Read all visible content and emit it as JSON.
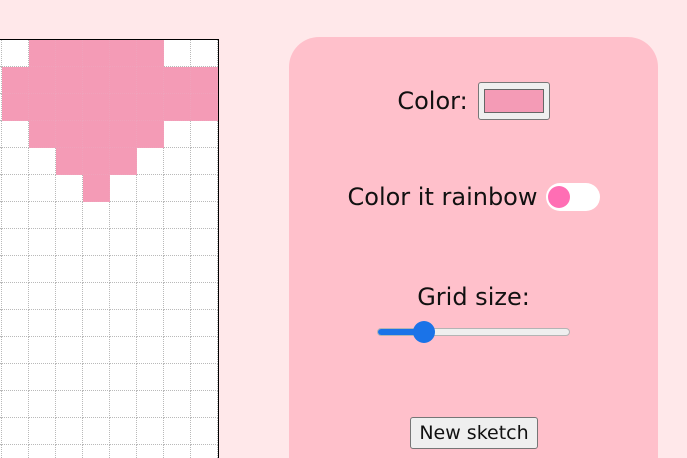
{
  "canvas": {
    "columns": 9,
    "rows": 16,
    "filled_color": "#f49bb6",
    "filled_cells": [
      [
        0,
        2
      ],
      [
        0,
        3
      ],
      [
        0,
        4
      ],
      [
        0,
        5
      ],
      [
        0,
        6
      ],
      [
        1,
        1
      ],
      [
        1,
        2
      ],
      [
        1,
        3
      ],
      [
        1,
        4
      ],
      [
        1,
        5
      ],
      [
        1,
        6
      ],
      [
        1,
        7
      ],
      [
        1,
        8
      ],
      [
        2,
        1
      ],
      [
        2,
        2
      ],
      [
        2,
        3
      ],
      [
        2,
        4
      ],
      [
        2,
        5
      ],
      [
        2,
        6
      ],
      [
        2,
        7
      ],
      [
        2,
        8
      ],
      [
        3,
        2
      ],
      [
        3,
        3
      ],
      [
        3,
        4
      ],
      [
        3,
        5
      ],
      [
        3,
        6
      ],
      [
        4,
        3
      ],
      [
        4,
        4
      ],
      [
        4,
        5
      ],
      [
        5,
        4
      ]
    ]
  },
  "controls": {
    "color_label": "Color:",
    "color_value": "#f49bb6",
    "rainbow_label": "Color it rainbow",
    "rainbow_on": false,
    "grid_size_label": "Grid size:",
    "grid_size_fraction": 0.21,
    "new_sketch_label": "New sketch"
  },
  "colors": {
    "page_background": "#ffe8ea",
    "panel_background": "#ffc0cb",
    "toggle_knob": "#ff6eb4",
    "slider_accent": "#1a73e8"
  }
}
